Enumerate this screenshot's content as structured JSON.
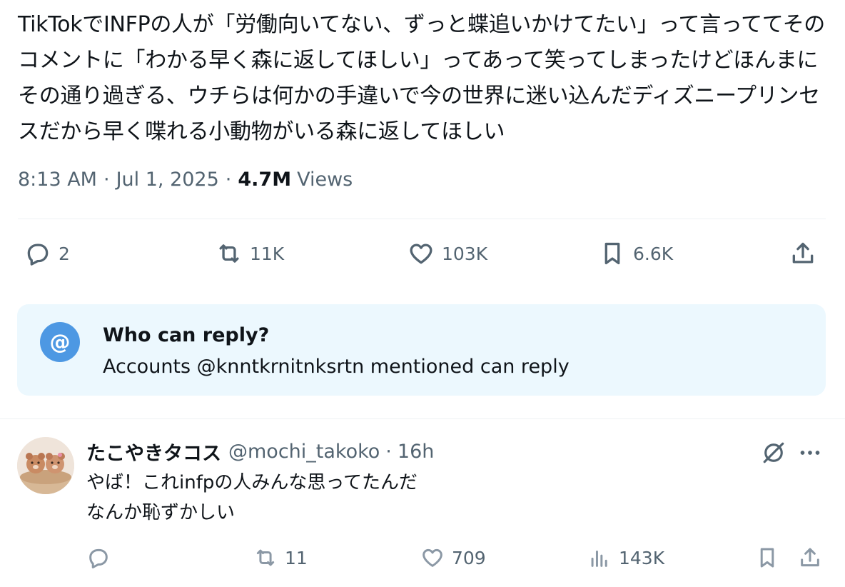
{
  "tweet": {
    "text": "TikTokでINFPの人が「労働向いてない、ずっと蝶追いかけてたい」って言っててそのコメントに「わかる早く森に返してほしい」ってあって笑ってしまったけどほんまにその通り過ぎる、ウチらは何かの手違いで今の世界に迷い込んだディズニープリンセスだから早く喋れる小動物がいる森に返してほしい",
    "time": "8:13 AM",
    "date": "Jul 1, 2025",
    "views_count": "4.7M",
    "views_label": "Views",
    "separator": "·"
  },
  "actions": {
    "replies": "2",
    "retweets": "11K",
    "likes": "103K",
    "bookmarks": "6.6K"
  },
  "who_can_reply": {
    "icon_glyph": "@",
    "title": "Who can reply?",
    "subtitle": "Accounts @knntkrnitnksrtn mentioned can reply"
  },
  "reply": {
    "name": "たこやきタコス",
    "handle": "@mochi_takoko",
    "separator": "·",
    "time": "16h",
    "more_glyph": "···",
    "text_line1": "やば！これinfpの人みんな思ってたんだ",
    "text_line2": "なんか恥ずかしい",
    "actions": {
      "replies": "",
      "retweets": "11",
      "likes": "709",
      "views": "143K"
    }
  },
  "colors": {
    "text_primary": "#0f1419",
    "text_secondary": "#536471",
    "info_box_bg": "#ecf8fe",
    "at_badge": "#4d98e3",
    "divider": "#eff3f4"
  },
  "icons": {
    "reply": "speech-bubble-icon",
    "retweet": "retweet-arrows-icon",
    "like": "heart-icon",
    "bookmark": "bookmark-icon",
    "share": "share-upload-icon",
    "views": "bar-chart-icon",
    "grok": "grok-slash-circle-icon",
    "more": "ellipsis-icon"
  }
}
